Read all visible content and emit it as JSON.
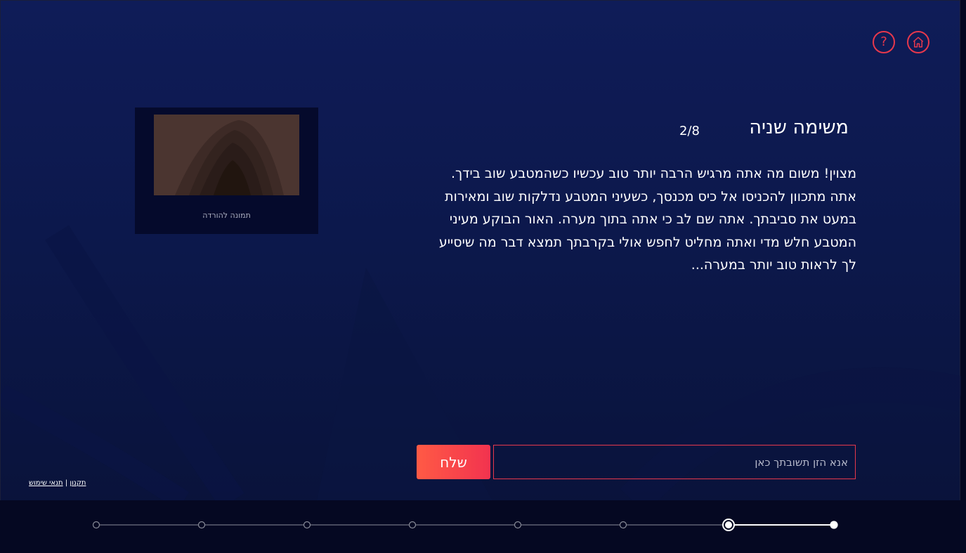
{
  "header": {
    "help_icon": "question-mark-icon",
    "home_icon": "home-icon"
  },
  "task": {
    "title": "משימה שניה",
    "counter": "2/8",
    "story": "מצוין! משום מה אתה מרגיש הרבה יותר טוב עכשיו כשהמטבע שוב בידך. אתה מתכוון להכניסו אל כיס מכנסך, כשעיני המטבע נדלקות שוב ומאירות במעט את סביבתך. אתה שם לב כי אתה בתוך מערה. האור הבוקע מעיני המטבע חלש מדי ואתה מחליט לחפש אולי בקרבתך תמצא דבר מה שיסייע לך לראות טוב יותר במערה..."
  },
  "image_card": {
    "download_label": "תמונה להורדה"
  },
  "answer": {
    "placeholder": "אנא הזן תשובתך כאן",
    "value": "",
    "send_label": "שלח"
  },
  "footer": {
    "terms_label": "תנאי שימוש",
    "separator": "|",
    "rules_label": "תקנון"
  },
  "progress": {
    "total_steps": 8,
    "current_step": 2,
    "active_color": "#ffffff",
    "inactive_color": "#8a8c99"
  },
  "colors": {
    "accent": "#e7384c",
    "button_gradient_start": "#ff5a45",
    "button_gradient_end": "#f2334f",
    "background": "#0f1c58"
  }
}
